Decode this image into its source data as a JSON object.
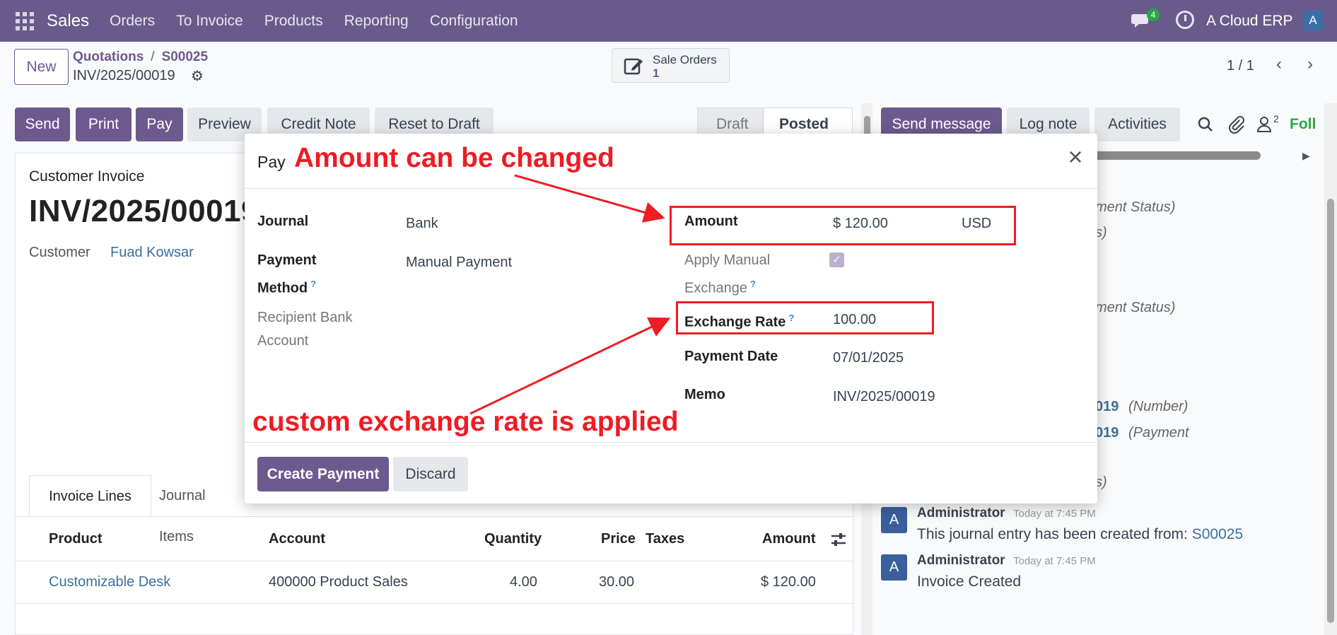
{
  "navbar": {
    "brand": "Sales",
    "menu": [
      "Orders",
      "To Invoice",
      "Products",
      "Reporting",
      "Configuration"
    ],
    "chat_badge": "4",
    "company": "A Cloud ERP",
    "user_initial": "A"
  },
  "control": {
    "new_label": "New",
    "breadcrumb": [
      "Quotations",
      "S00025"
    ],
    "record_name": "INV/2025/00019",
    "smart_button": {
      "label": "Sale Orders",
      "count": "1"
    },
    "pager": "1 / 1"
  },
  "actions": {
    "send": "Send",
    "print": "Print",
    "pay": "Pay",
    "preview": "Preview",
    "credit_note": "Credit Note",
    "reset_draft": "Reset to Draft"
  },
  "status": {
    "draft": "Draft",
    "posted": "Posted"
  },
  "form": {
    "doc_type": "Customer Invoice",
    "doc_name": "INV/2025/00019",
    "customer_label": "Customer",
    "customer_value": "Fuad Kowsar",
    "tabs": [
      "Invoice Lines",
      "Journal Items"
    ],
    "columns": [
      "Product",
      "Account",
      "Quantity",
      "Price",
      "Taxes",
      "Amount"
    ],
    "lines": [
      {
        "product": "Customizable Desk",
        "account": "400000 Product Sales",
        "quantity": "4.00",
        "price": "30.00",
        "taxes": "",
        "amount": "$ 120.00"
      }
    ]
  },
  "chatter": {
    "send_message": "Send message",
    "log_note": "Log note",
    "activities": "Activities",
    "followers_count": "2",
    "follow": "Foll",
    "fragments": [
      "ment Status)",
      "s)",
      "ment Status)",
      "s)"
    ],
    "links": [
      "019",
      "019"
    ],
    "link_suffix": [
      "(Number)",
      "(Payment"
    ],
    "messages": [
      {
        "avatar": "A",
        "author": "Administrator",
        "time": "Today at 7:45 PM",
        "body": "This journal entry has been created from: ",
        "link": "S00025"
      },
      {
        "avatar": "A",
        "author": "Administrator",
        "time": "Today at 7:45 PM",
        "body": "Invoice Created",
        "link": ""
      }
    ]
  },
  "dialog": {
    "title": "Pay",
    "left": [
      {
        "label": "Journal",
        "value": "Bank"
      },
      {
        "label": "Payment Method",
        "value": "Manual Payment"
      },
      {
        "label": "Recipient Bank Account",
        "value": ""
      }
    ],
    "right": {
      "amount_label": "Amount",
      "amount_value": "$ 120.00",
      "currency": "USD",
      "manual_label": "Apply Manual Exchange",
      "manual_checked": true,
      "rate_label": "Exchange Rate",
      "rate_value": "100.00",
      "date_label": "Payment Date",
      "date_value": "07/01/2025",
      "memo_label": "Memo",
      "memo_value": "INV/2025/00019"
    },
    "create_label": "Create Payment",
    "discard_label": "Discard"
  },
  "annotations": {
    "top": "Amount can be changed",
    "bottom": "custom exchange rate is applied",
    "color": "#ee1c24"
  }
}
